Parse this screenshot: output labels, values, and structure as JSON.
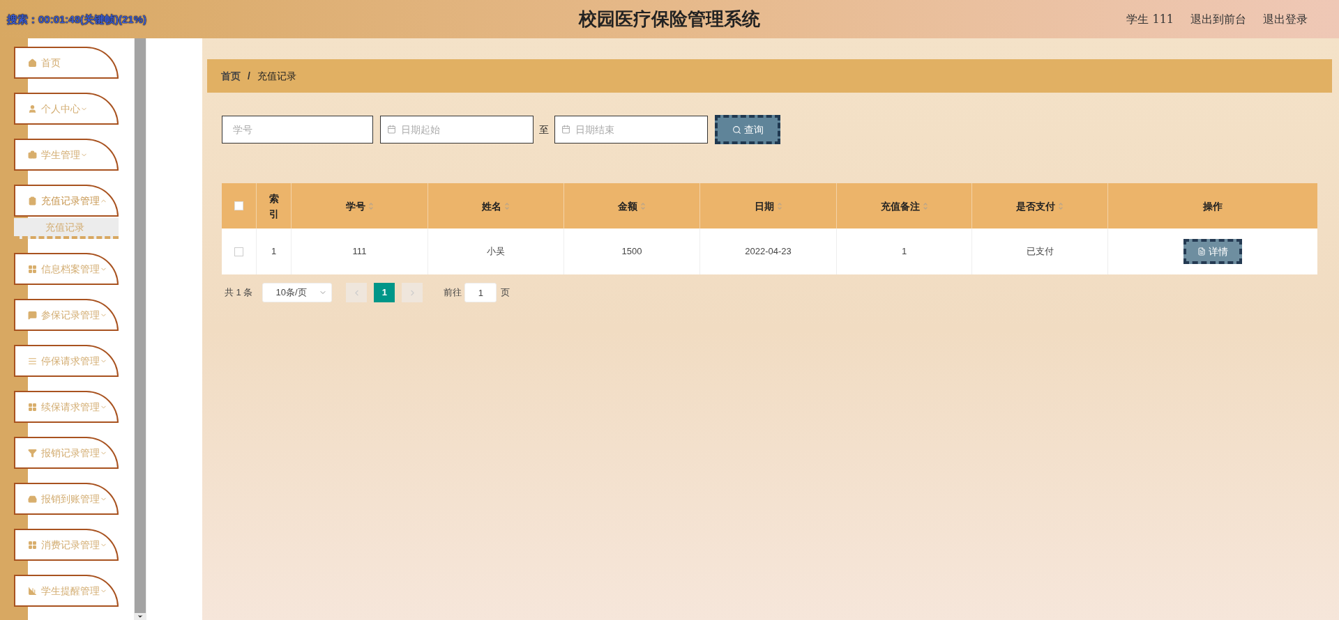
{
  "player_overlay": {
    "text": "搜索：00:01:48(关键帧)(21%)"
  },
  "header": {
    "title": "校园医疗保险管理系统",
    "user_role": "学生",
    "user_name": "111",
    "links": [
      "退出到前台",
      "退出登录"
    ]
  },
  "sidebar": {
    "items": [
      {
        "label": "首页",
        "expandable": false,
        "expanded": false
      },
      {
        "label": "个人中心",
        "expandable": true,
        "expanded": false
      },
      {
        "label": "学生管理",
        "expandable": true,
        "expanded": false
      },
      {
        "label": "充值记录管理",
        "expandable": true,
        "expanded": true,
        "children": [
          {
            "label": "充值记录",
            "selected": true
          }
        ]
      },
      {
        "label": "信息档案管理",
        "expandable": true,
        "expanded": false
      },
      {
        "label": "参保记录管理",
        "expandable": true,
        "expanded": false
      },
      {
        "label": "停保请求管理",
        "expandable": true,
        "expanded": false
      },
      {
        "label": "续保请求管理",
        "expandable": true,
        "expanded": false
      },
      {
        "label": "报销记录管理",
        "expandable": true,
        "expanded": false
      },
      {
        "label": "报销到账管理",
        "expandable": true,
        "expanded": false
      },
      {
        "label": "消费记录管理",
        "expandable": true,
        "expanded": false
      },
      {
        "label": "学生提醒管理",
        "expandable": true,
        "expanded": false
      }
    ]
  },
  "breadcrumb": {
    "items": [
      "首页",
      "充值记录"
    ],
    "separator": "/"
  },
  "search": {
    "student_id": {
      "placeholder": "学号"
    },
    "date_from": {
      "placeholder": "日期起始"
    },
    "range_separator": "至",
    "date_to": {
      "placeholder": "日期结束"
    },
    "button": "查询"
  },
  "table": {
    "select_all_checked": false,
    "columns": [
      {
        "label": "索引",
        "sortable": false
      },
      {
        "label": "学号",
        "sortable": true
      },
      {
        "label": "姓名",
        "sortable": true
      },
      {
        "label": "金额",
        "sortable": true
      },
      {
        "label": "日期",
        "sortable": true
      },
      {
        "label": "充值备注",
        "sortable": true
      },
      {
        "label": "是否支付",
        "sortable": true
      },
      {
        "label": "操作",
        "sortable": false
      }
    ],
    "rows": [
      {
        "checked": false,
        "cells": [
          "1",
          "111",
          "小吴",
          "1500",
          "2022-04-23",
          "1",
          "已支付"
        ],
        "action": "详情"
      }
    ]
  },
  "pagination": {
    "total": "共 1 条",
    "page_size": "10条/页",
    "pages": [
      {
        "label": "1",
        "selected": true
      }
    ],
    "prev_disabled": true,
    "next_disabled": true,
    "goto_label": "前往",
    "goto_value": "1",
    "goto_suffix": "页"
  }
}
